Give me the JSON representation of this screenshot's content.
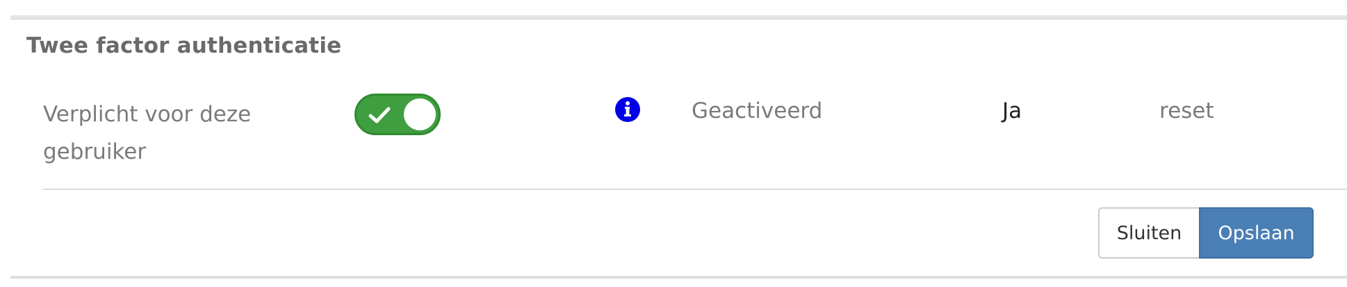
{
  "section": {
    "title": "Twee factor authenticatie"
  },
  "setting": {
    "label": "Verplicht voor deze gebruiker",
    "toggle_on": true,
    "toggle_color": "#3f9e3f",
    "info_icon": "info-icon",
    "info_color": "#0000e6"
  },
  "status": {
    "label": "Geactiveerd",
    "value": "Ja",
    "reset_label": "reset"
  },
  "actions": {
    "close_label": "Sluiten",
    "save_label": "Opslaan",
    "save_color": "#4a7fb5"
  }
}
